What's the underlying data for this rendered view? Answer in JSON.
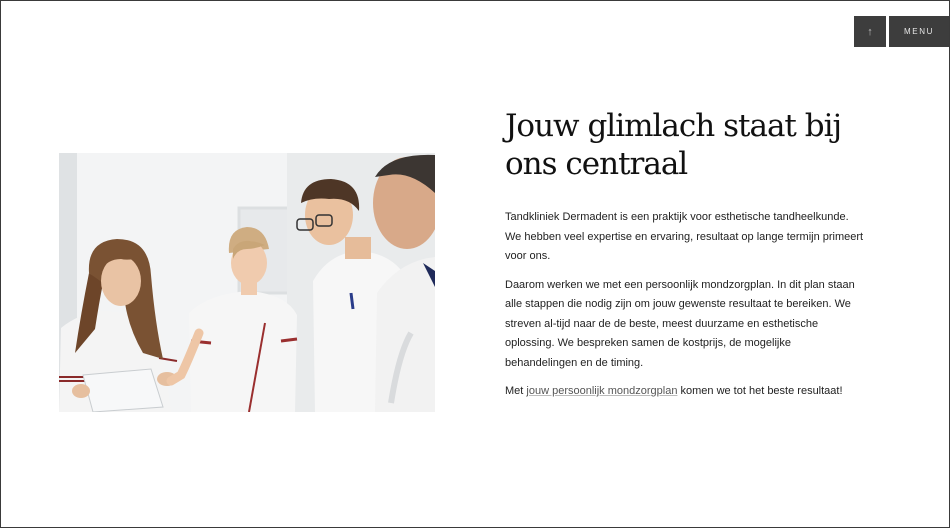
{
  "controls": {
    "scroll_top_icon": "arrow-up-icon",
    "scroll_top_symbol": "↑",
    "menu_label": "MENU"
  },
  "photo": {
    "alt": "Team van tandkliniek Dermadent in witte uniformen"
  },
  "content": {
    "heading": "Jouw glimlach staat bij ons centraal",
    "paragraph1": "Tandkliniek Dermadent is een praktijk voor esthetische tandheelkunde. We hebben veel expertise en ervaring, resultaat op lange termijn primeert voor ons.",
    "paragraph2": "Daarom werken we met een persoonlijk mondzorgplan. In dit plan staan alle stappen die nodig zijn om jouw gewenste resultaat te bereiken. We streven al-tijd naar de de beste, meest duurzame en esthetische oplossing. We bespreken samen de kostprijs, de mogelijke behandelingen en de timing.",
    "paragraph3_before": "Met ",
    "paragraph3_link": "jouw persoonlijk mondzorgplan",
    "paragraph3_after": " komen we tot het beste resultaat!"
  },
  "colors": {
    "button_bg": "#3d3d3d",
    "text": "#1a1a1a",
    "link": "#555555"
  }
}
